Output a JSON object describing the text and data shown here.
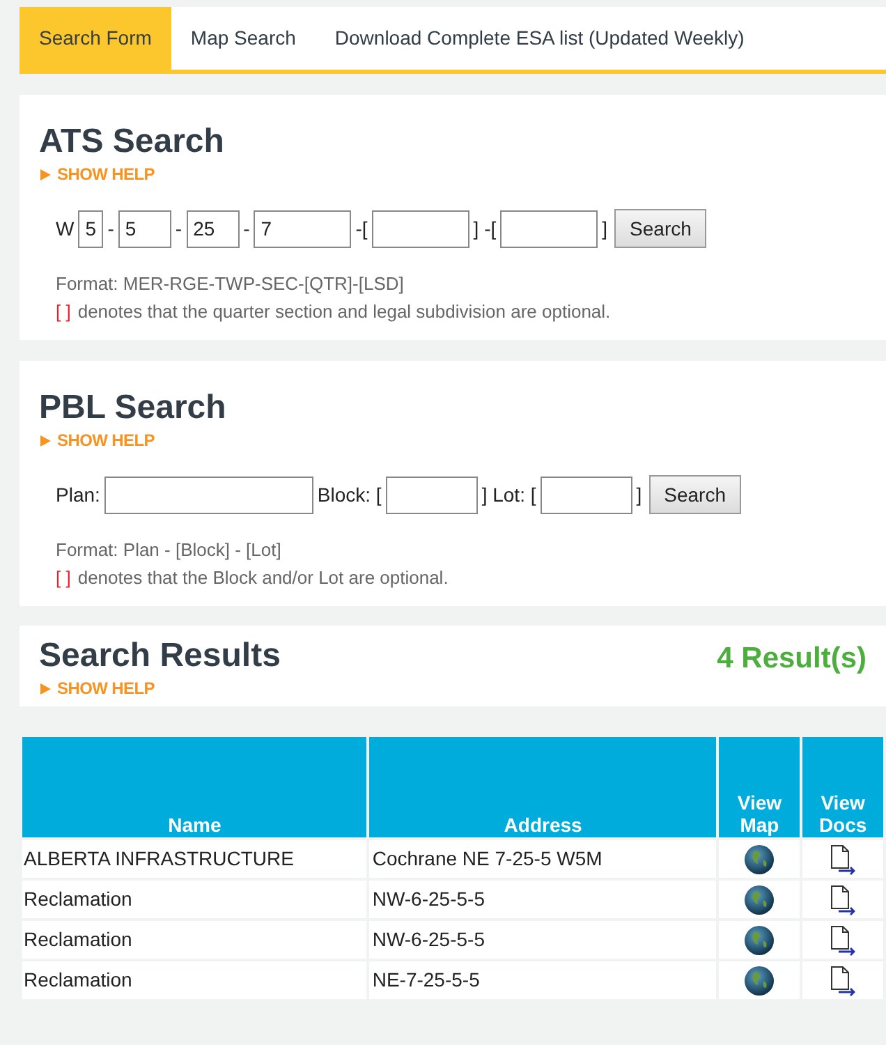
{
  "tabs": [
    {
      "label": "Search Form",
      "selected": true
    },
    {
      "label": "Map Search",
      "selected": false
    },
    {
      "label": "Download Complete ESA list (Updated Weekly)",
      "selected": false
    }
  ],
  "ats_search": {
    "title": "ATS Search",
    "help": "SHOW HELP",
    "parts": [
      {
        "kind": "text",
        "text": "W"
      },
      {
        "kind": "field",
        "value": "5"
      },
      {
        "kind": "text",
        "text": "-"
      },
      {
        "kind": "field",
        "value": "5"
      },
      {
        "kind": "text",
        "text": "-"
      },
      {
        "kind": "field",
        "value": "25"
      },
      {
        "kind": "text",
        "text": "-"
      },
      {
        "kind": "field",
        "value": "7"
      },
      {
        "kind": "text",
        "text": "-["
      },
      {
        "kind": "field"
      },
      {
        "kind": "text",
        "text": "] -["
      },
      {
        "kind": "field"
      },
      {
        "kind": "text",
        "text": "]"
      }
    ],
    "button": "Search",
    "format": "Format: MER-RGE-TWP-SEC-[QTR]-[LSD]",
    "note_marker": "[ ]",
    "note": "denotes that the quarter section and legal subdivision are optional."
  },
  "pbl_search": {
    "title": "PBL Search",
    "help": "SHOW HELP",
    "parts": [
      {
        "kind": "text",
        "text": "Plan:"
      },
      {
        "kind": "field"
      },
      {
        "kind": "text",
        "text": "Block: ["
      },
      {
        "kind": "field"
      },
      {
        "kind": "text",
        "text": "] Lot: ["
      },
      {
        "kind": "field"
      },
      {
        "kind": "text",
        "text": "]"
      }
    ],
    "button": "Search",
    "format": "Format: Plan - [Block] - [Lot]",
    "note_marker": "[ ]",
    "note": "denotes that the Block and/or Lot are optional."
  },
  "results": {
    "title": "Search Results",
    "count": "4 Result(s)",
    "help": "SHOW HELP"
  },
  "table": {
    "columns": [
      "Name",
      "Address",
      "View Map",
      "View Docs"
    ],
    "rows": [
      {
        "name": "ALBERTA INFRASTRUCTURE",
        "address": "Cochrane NE 7-25-5 W5M"
      },
      {
        "name": "Reclamation",
        "address": "NW-6-25-5-5"
      },
      {
        "name": "Reclamation",
        "address": "NW-6-25-5-5"
      },
      {
        "name": "Reclamation",
        "address": "NE-7-25-5-5"
      }
    ]
  }
}
